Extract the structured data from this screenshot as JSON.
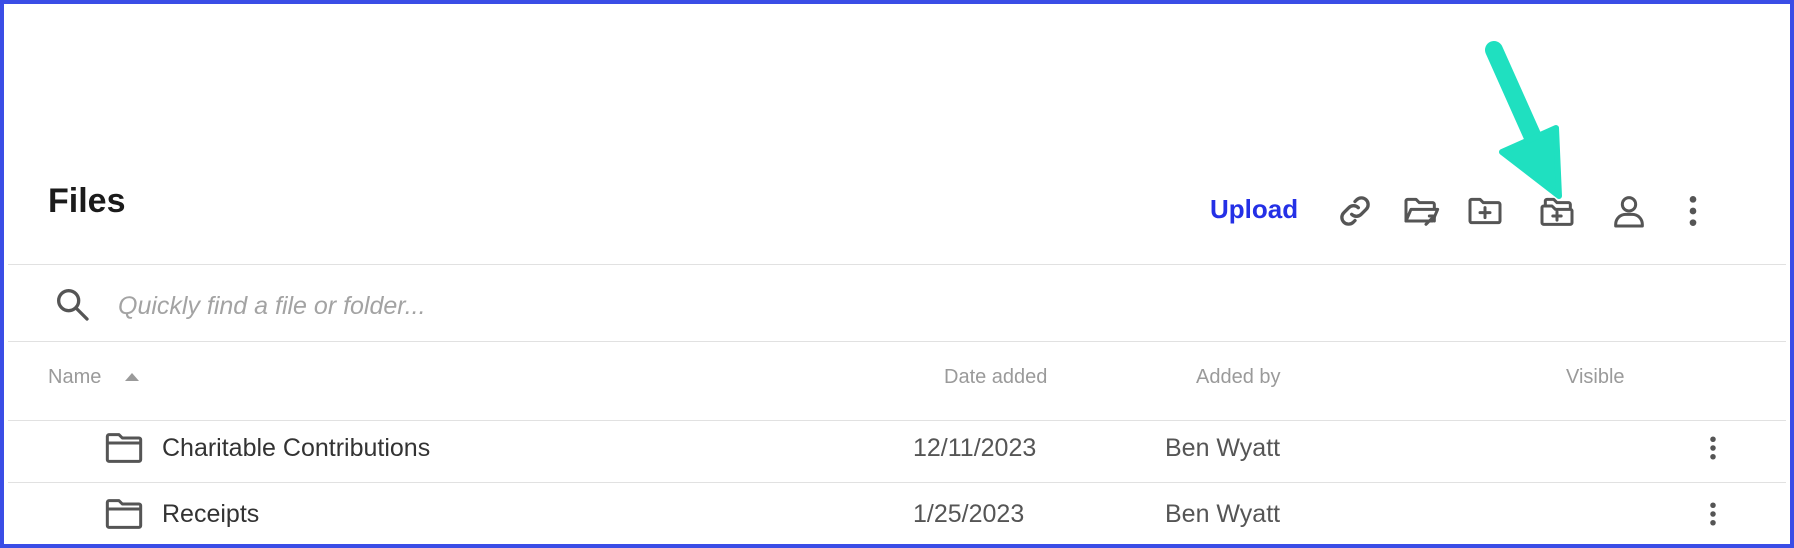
{
  "header": {
    "title": "Files",
    "upload_label": "Upload",
    "toolbar_icons": [
      "link-icon",
      "move-folder-icon",
      "new-folder-icon",
      "add-folder-icon",
      "user-icon",
      "more-vertical-icon"
    ]
  },
  "search": {
    "placeholder": "Quickly find a file or folder...",
    "icon": "search-icon"
  },
  "table": {
    "columns": [
      "Name",
      "Date added",
      "Added by",
      "Visible"
    ],
    "sort_column": "Name",
    "sort_direction": "ascending",
    "rows": [
      {
        "icon": "folder-icon",
        "name": "Charitable Contributions",
        "date_added": "12/11/2023",
        "added_by": "Ben Wyatt"
      },
      {
        "icon": "folder-icon",
        "name": "Receipts",
        "date_added": "1/25/2023",
        "added_by": "Ben Wyatt"
      }
    ]
  },
  "colors": {
    "frame_border": "#3a4de6",
    "upload_link": "#2430e6",
    "annotation_arrow": "#1fe0c0",
    "icon_stroke": "#555555"
  }
}
